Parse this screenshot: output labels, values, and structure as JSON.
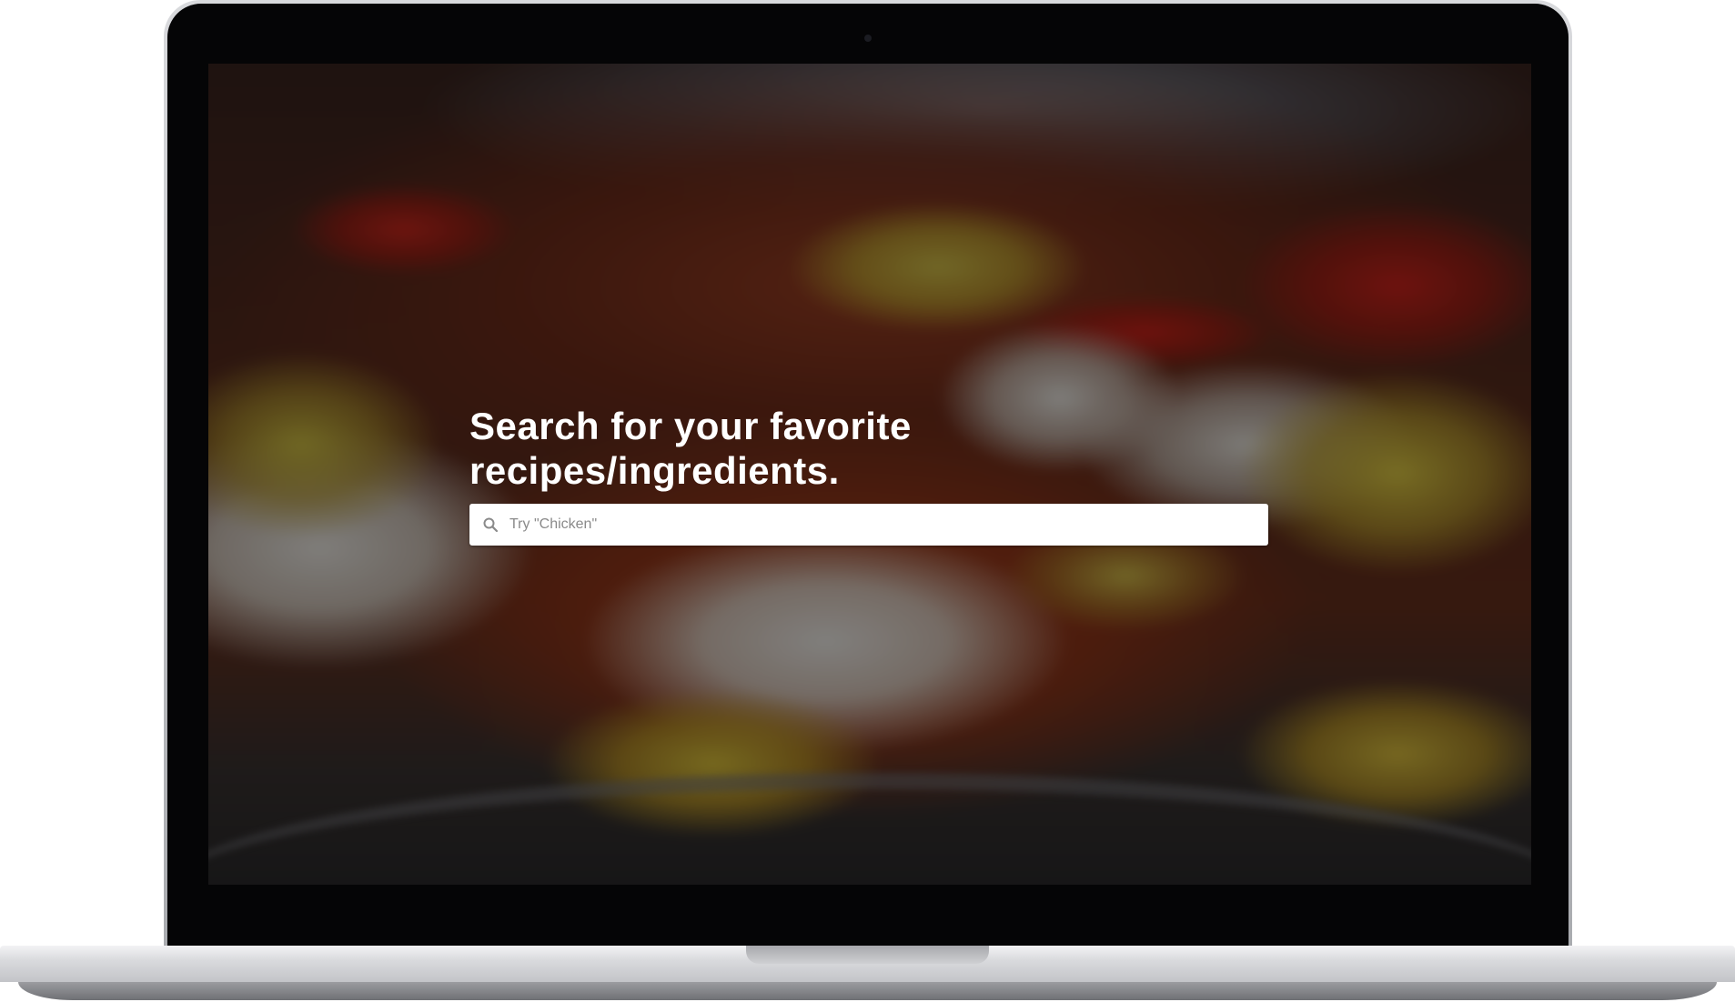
{
  "hero": {
    "title": "Search for your favorite recipes/ingredients."
  },
  "search": {
    "placeholder": "Try \"Chicken\"",
    "value": "",
    "icon": "search-icon"
  },
  "colors": {
    "overlay": "#000000",
    "title_text": "#ffffff",
    "search_background": "#ffffff",
    "placeholder_text": "#8a8a8a"
  }
}
